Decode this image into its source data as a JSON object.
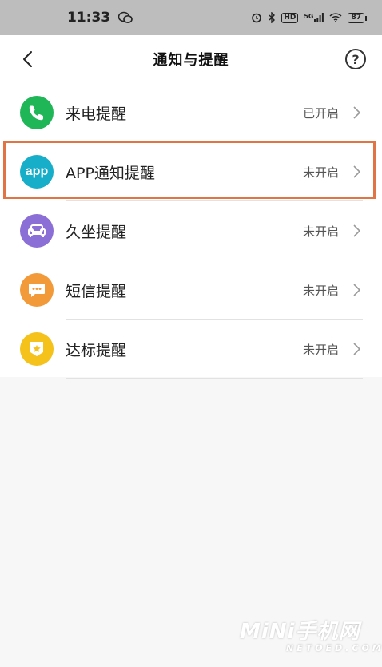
{
  "status_bar": {
    "time": "11:33",
    "network_label": "5G",
    "hd_label": "HD",
    "battery_level": "87",
    "icons": [
      "wechat-icon",
      "alarm-icon",
      "bluetooth-icon",
      "signal-icon",
      "wifi-icon"
    ]
  },
  "header": {
    "title": "通知与提醒",
    "back_icon": "chevron-left-icon",
    "help_label": "?"
  },
  "items": [
    {
      "label": "来电提醒",
      "status": "已开启",
      "icon": "phone-icon",
      "color": "#1fb657"
    },
    {
      "label": "APP通知提醒",
      "status": "未开启",
      "icon": "app-icon",
      "icon_text": "app",
      "color": "#17aec9"
    },
    {
      "label": "久坐提醒",
      "status": "未开启",
      "icon": "sofa-icon",
      "color": "#8b6fd6"
    },
    {
      "label": "短信提醒",
      "status": "未开启",
      "icon": "message-icon",
      "color": "#f29a3a"
    },
    {
      "label": "达标提醒",
      "status": "未开启",
      "icon": "badge-star-icon",
      "color": "#f5c21b"
    }
  ],
  "highlight_color": "#e07444",
  "watermark": {
    "main": "MiNi手机网",
    "sub": "NETOED.COM"
  }
}
